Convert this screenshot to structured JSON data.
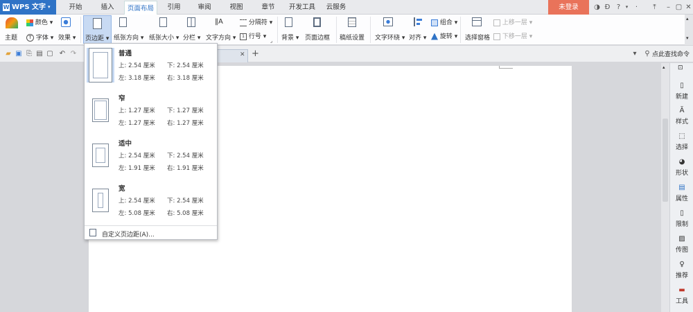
{
  "titlebar": {
    "app_name": "WPS 文字",
    "tabs": [
      "开始",
      "插入",
      "页面布局",
      "引用",
      "审阅",
      "视图",
      "章节",
      "开发工具",
      "云服务"
    ],
    "active_tab": "页面布局",
    "login_label": "未登录",
    "help_label": "?"
  },
  "ribbon": {
    "theme": "主题",
    "colors": "颜色",
    "font": "字体",
    "effects": "效果",
    "margins": "页边距",
    "orientation": "纸张方向",
    "size": "纸张大小",
    "columns": "分栏",
    "text_direction": "文字方向",
    "separator": "分隔符",
    "line_number": "行号",
    "background": "背景",
    "page_border": "页面边框",
    "draft_paper": "稿纸设置",
    "wrap_text": "文字环绕",
    "align": "对齐",
    "group": "组合",
    "rotate": "旋转",
    "selection_pane": "选择窗格",
    "bring_forward": "上移一层",
    "send_backward": "下移一层"
  },
  "qat": {
    "search_cmd": "点此查找命令",
    "new_tab": "+"
  },
  "margins_menu": {
    "options": [
      {
        "name": "普通",
        "top": "上: 2.54 厘米",
        "bottom": "下: 2.54 厘米",
        "left": "左: 3.18 厘米",
        "right": "右: 3.18 厘米"
      },
      {
        "name": "窄",
        "top": "上: 1.27 厘米",
        "bottom": "下: 1.27 厘米",
        "left": "左: 1.27 厘米",
        "right": "右: 1.27 厘米"
      },
      {
        "name": "适中",
        "top": "上: 2.54 厘米",
        "bottom": "下: 2.54 厘米",
        "left": "左: 1.91 厘米",
        "right": "右: 1.91 厘米"
      },
      {
        "name": "宽",
        "top": "上: 2.54 厘米",
        "bottom": "下: 2.54 厘米",
        "left": "左: 5.08 厘米",
        "right": "右: 5.08 厘米"
      }
    ],
    "selected": "普通",
    "custom": "自定义页边距(A)..."
  },
  "right_panel": [
    "新建",
    "样式",
    "选择",
    "形状",
    "属性",
    "限制",
    "传图",
    "推荐",
    "工具"
  ],
  "colors": {
    "accent": "#2f73c6",
    "login": "#e9735a"
  }
}
